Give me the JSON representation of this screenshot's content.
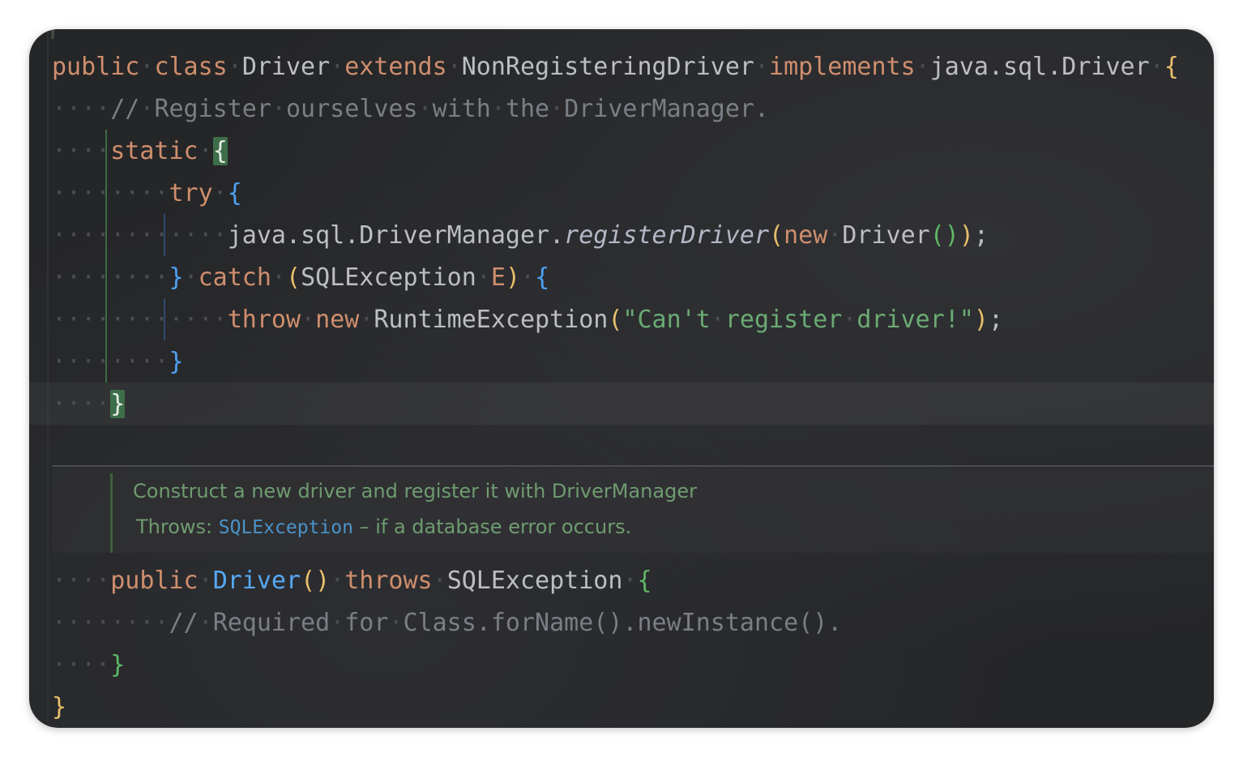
{
  "code": {
    "l1": {
      "t1": "public",
      "t2": "class",
      "t3": "Driver",
      "t4": "extends",
      "t5": "NonRegisteringDriver",
      "t6": "implements",
      "t7": "java.sql.Driver",
      "t8": "{"
    },
    "l2": {
      "t1": "// Register ourselves with the DriverManager."
    },
    "l3": {
      "t1": "static",
      "t2": "{"
    },
    "l4": {
      "t1": "try",
      "t2": "{"
    },
    "l5": {
      "t1": "java.sql.DriverManager.",
      "t2": "registerDriver",
      "t3": "(",
      "t4": "new",
      "t5": "Driver",
      "t6": "()",
      "t7": ")",
      "t8": ";"
    },
    "l6": {
      "t1": "}",
      "t2": "catch",
      "t3": "(",
      "t4": "SQLException",
      "t5": "E",
      "t6": ")",
      "t7": "{"
    },
    "l7": {
      "t1": "throw",
      "t2": "new",
      "t3": "RuntimeException",
      "t4": "(",
      "t5": "\"Can't register driver!\"",
      "t6": ")",
      "t7": ";"
    },
    "l8": {
      "t1": "}"
    },
    "l9": {
      "t1": "}"
    },
    "l10": {
      "t1": "public",
      "t2": "Driver",
      "t3": "()",
      "t4": "throws",
      "t5": "SQLException",
      "t6": "{"
    },
    "l11": {
      "t1": "// Required for Class.forName().newInstance()."
    },
    "l12": {
      "t1": "}"
    },
    "l13": {
      "t1": "}"
    }
  },
  "doc": {
    "summary": "Construct a new driver and register it with DriverManager",
    "throws_label": "Throws:",
    "throws_type": "SQLException",
    "throws_desc": "– if a database error occurs."
  }
}
